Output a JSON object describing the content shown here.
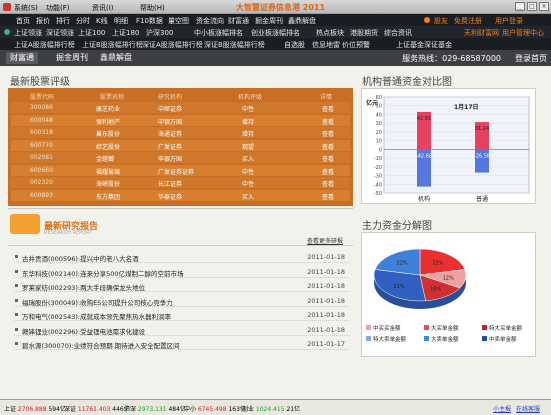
{
  "window": {
    "title": "大智慧证券信息港 2011",
    "menu": [
      "系统(S)",
      "功能(F)",
      "资讯(I)",
      "帮助(H)"
    ]
  },
  "toolbar1": {
    "items": [
      "首页",
      "报价",
      "排行",
      "分时",
      "K线",
      "明细",
      "F10数据",
      "量空图",
      "资金流向",
      "财富通",
      "掘金周刊",
      "鑫鼎解盘"
    ],
    "right": [
      "股友",
      "免费注册",
      "用户登录"
    ]
  },
  "toolbar2": {
    "items": [
      "上证领涨",
      "深证领涨",
      "上证100",
      "上证180",
      "沪深300",
      "中小板涨幅排名",
      "创业板涨幅排名",
      "热点板块",
      "港股期货",
      "综合资讯"
    ],
    "right": [
      "天利财富网",
      "用户管理中心"
    ]
  },
  "toolbar3": {
    "items": [
      "上证A股涨幅排行榜",
      "上证B股涨幅排行榜",
      "深证A股涨幅排行榜",
      "深证B股涨幅排行榜",
      "自选股",
      "信息地雷",
      "价位预警",
      "上证基金",
      "深证基金"
    ]
  },
  "nav": {
    "tabs": [
      "财富通",
      "掘金周刊",
      "鑫鼎解盘"
    ],
    "hotline": "服务热线：029-68587000",
    "login": "登录首页"
  },
  "ratings": {
    "title": "最新股票评级",
    "headers": [
      "股票代码",
      "股票名称",
      "研究机构",
      "机构评级",
      "详情"
    ],
    "rows": [
      [
        "300086",
        "康芝药业",
        "中邮证券",
        "中性",
        "查看"
      ],
      [
        "600048",
        "保利地产",
        "中银万国",
        "增持",
        "查看"
      ],
      [
        "600318",
        "巢东股份",
        "海通证券",
        "增持",
        "查看"
      ],
      [
        "600770",
        "综艺股份",
        "广发证券",
        "观望",
        "查看"
      ],
      [
        "002081",
        "金螳螂",
        "申银万国",
        "买入",
        "查看"
      ],
      [
        "600660",
        "福耀玻璃",
        "广发证券证券",
        "中性",
        "查看"
      ],
      [
        "002320",
        "海峡股份",
        "长江证券",
        "中性",
        "查看"
      ],
      [
        "600893",
        "东方集团",
        "华泰证券",
        "买入",
        "查看"
      ]
    ]
  },
  "reports": {
    "title": "最新研究报告",
    "subtitle": "RESEARCH REPORT",
    "more": "查看更多研报",
    "items": [
      [
        "古井贡酒(000596):提兴中的老八大名酒",
        "2011-01-18"
      ],
      [
        "东华科技(002140):连来分享500亿煤制二醇的空前市场",
        "2011-01-18"
      ],
      [
        "罗莱家纺(002293):两大手段确保龙头地位",
        "2011-01-18"
      ],
      [
        "福瑞股份(300049):收购ES公司提升公司核心竞争力",
        "2011-01-18"
      ],
      [
        "万和电气(002543):成就成本领先聚焦热水器利润率",
        "2011-01-18"
      ],
      [
        "赣锋锂业(002296):受益锂电池需求化建设",
        "2011-01-18"
      ],
      [
        "碧水源(300070):业绩符合预期 期待进入安全配置区间",
        "2011-01-17"
      ]
    ]
  },
  "fundchart": {
    "title": "机构普通资金对比图",
    "unit": "亿元",
    "date": "1月17日",
    "categories": [
      "机构",
      "普通"
    ],
    "series": [
      {
        "name": "流入",
        "values": [
          42.91,
          31.24
        ]
      },
      {
        "name": "流出",
        "values": [
          -42.68,
          -26.58
        ]
      }
    ],
    "ylim": [
      -50,
      60
    ],
    "colors": {
      "in": "#e84060",
      "out": "#5577dd"
    }
  },
  "piechart": {
    "title": "主力资金分解图",
    "type": "pie",
    "values": [
      22,
      12,
      15,
      31,
      22
    ],
    "labels": [
      "22%",
      "12%",
      "15%",
      "31%",
      "22%"
    ],
    "colors": [
      "#e83030",
      "#f0a0a0",
      "#d03030",
      "#3060c0",
      "#4080d8"
    ],
    "legend": [
      "中买买金额",
      "大买单金额",
      "特大买单金额",
      "特大卖单金额",
      "大卖单金额",
      "中卖单金额"
    ],
    "legend_colors": [
      "#f0a0a0",
      "#e85050",
      "#c82020",
      "#88aadd",
      "#4488dd",
      "#2050a0"
    ]
  },
  "status": {
    "items": [
      {
        "label": "上证",
        "value": "2706.888",
        "chg": "594亿"
      },
      {
        "label": "深证",
        "value": "11761.403",
        "chg": "446亿"
      },
      {
        "label": "沪深",
        "value": "2973.131",
        "chg": "484亿"
      },
      {
        "label": "中小",
        "value": "6745.498",
        "chg": "163亿"
      },
      {
        "label": "创业",
        "value": "1024.415",
        "chg": "21亿"
      }
    ],
    "links": [
      "小主报",
      "在线客服"
    ]
  }
}
